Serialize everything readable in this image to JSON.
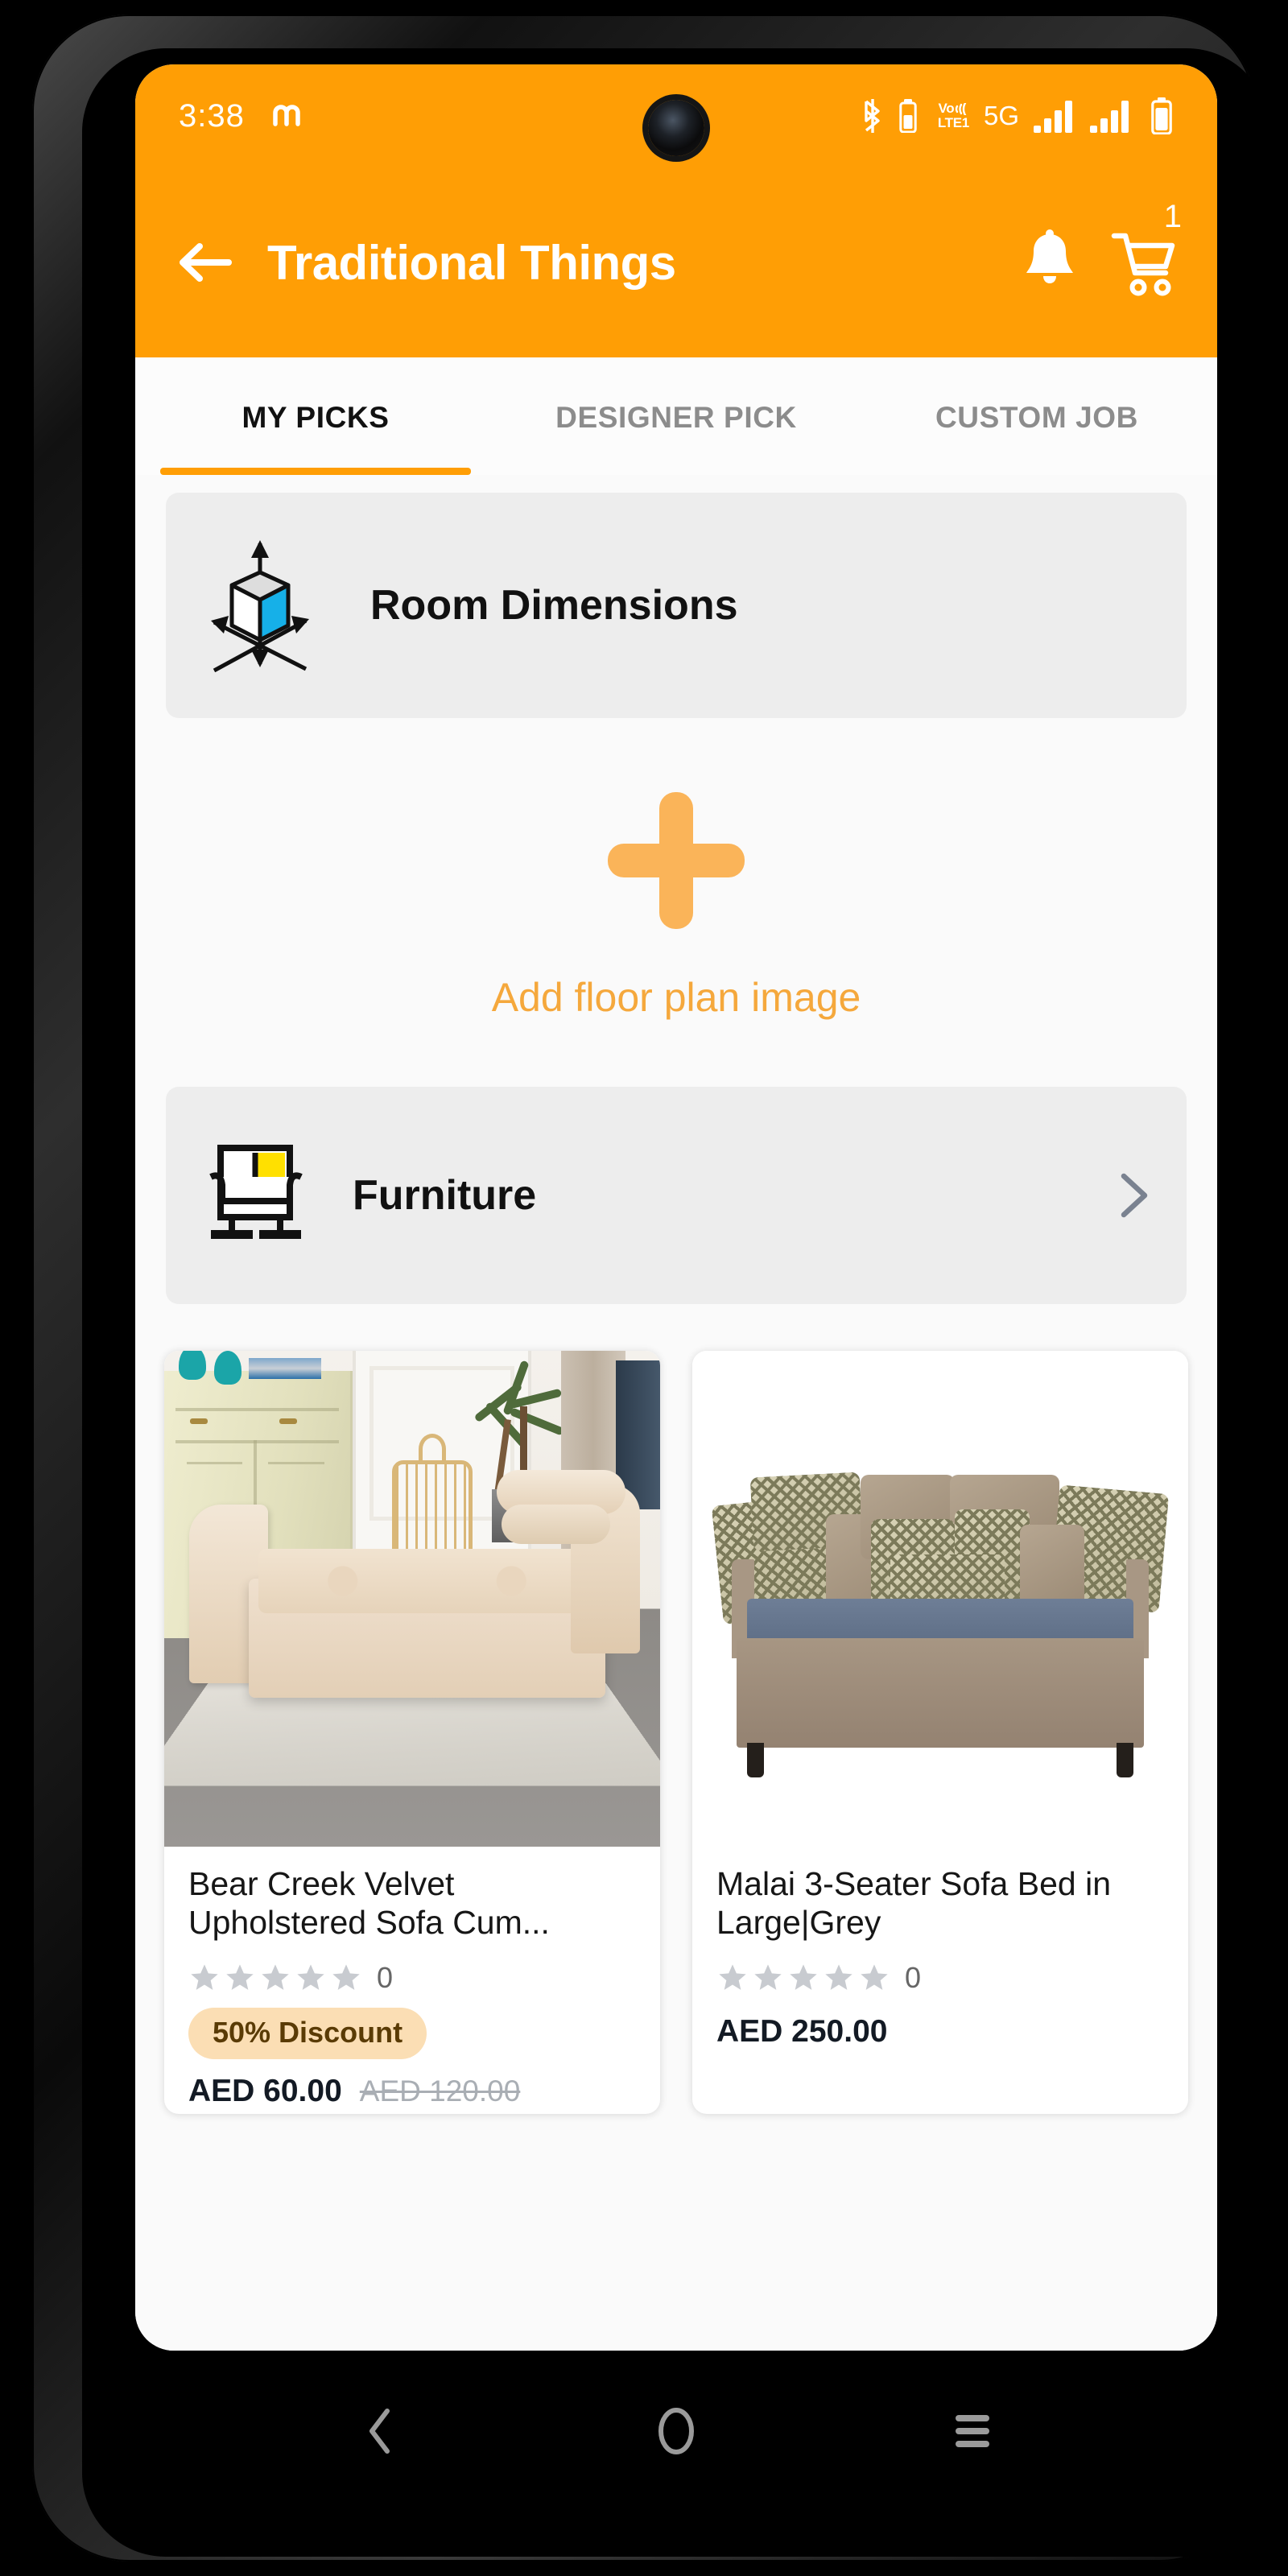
{
  "status_bar": {
    "clock": "3:38",
    "app_notification_icon": "m-letter-icon",
    "network_label": "5G",
    "volte_line1": "Vo",
    "volte_line2": "LTE1",
    "icons": [
      "bluetooth-icon",
      "bluetooth-battery-icon",
      "volte-icon",
      "5g-icon",
      "signal-bars-sim1-icon",
      "signal-bars-sim2-icon",
      "battery-icon"
    ]
  },
  "app_bar": {
    "back_icon": "arrow-left-icon",
    "title": "Traditional Things",
    "bell_icon": "bell-icon",
    "cart_icon": "shopping-cart-icon",
    "cart_badge": "1"
  },
  "tabs": [
    {
      "label": "MY PICKS",
      "active": true
    },
    {
      "label": "DESIGNER PICK",
      "active": false
    },
    {
      "label": "CUSTOM JOB",
      "active": false
    }
  ],
  "rows": {
    "room_dimensions": {
      "label": "Room Dimensions",
      "icon": "room-dimensions-cube-icon"
    },
    "furniture": {
      "label": "Furniture",
      "icon": "armchair-icon",
      "chevron": "chevron-right-icon"
    }
  },
  "add_floor_plan": {
    "label": "Add floor plan image",
    "icon": "plus-icon"
  },
  "products": [
    {
      "title": "Bear Creek Velvet Upholstered Sofa Cum...",
      "image_alt": "cream-velvet-tufted-chaise-bench",
      "stars": 5,
      "stars_filled": 0,
      "rating_count": "0",
      "discount_badge": "50% Discount",
      "price": "AED 60.00",
      "old_price": "AED 120.00"
    },
    {
      "title": "Malai 3-Seater Sofa Bed in Large|Grey",
      "image_alt": "taupe-sofa-bed-with-pillows",
      "stars": 5,
      "stars_filled": 0,
      "rating_count": "0",
      "discount_badge": null,
      "price": "AED 250.00",
      "old_price": null
    }
  ],
  "nav_bar": {
    "back": "nav-back-icon",
    "home": "nav-home-icon",
    "recents": "nav-recents-icon"
  },
  "colors": {
    "brand_orange": "#FF9E05",
    "accent_orange_light": "#F5A83C",
    "card_grey": "#EDEDED",
    "page_bg": "#FAFAFA",
    "badge_bg": "#FBDEB4",
    "badge_text": "#5A3B05",
    "star_grey": "#C8CBD0",
    "price_text": "#131A24",
    "old_price_text": "#A9AEB4",
    "tab_inactive": "#8C8C8C"
  }
}
